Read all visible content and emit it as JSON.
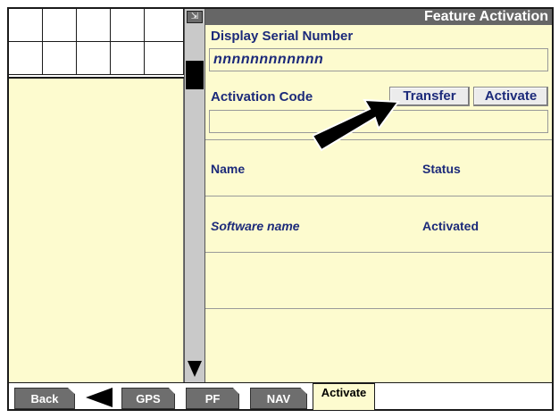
{
  "header": {
    "title": "Feature Activation"
  },
  "serial": {
    "label": "Display Serial Number",
    "value": "nnnnnnnnnnnn"
  },
  "activation": {
    "label": "Activation Code",
    "value": "",
    "transfer_label": "Transfer",
    "activate_label": "Activate"
  },
  "table": {
    "columns": [
      "Name",
      "Status"
    ],
    "rows": [
      {
        "name": "Software name",
        "status": "Activated"
      }
    ]
  },
  "tabs": {
    "back": "Back",
    "gps": "GPS",
    "pf": "PF",
    "nav": "NAV",
    "activate": "Activate"
  },
  "icons": {
    "pointer": "black-arrow-icon",
    "back": "left-arrow-icon",
    "scroll_down": "down-arrow-icon"
  },
  "colors": {
    "background": "#fdfbcf",
    "titlebar": "#666666",
    "text": "#1c2a7a"
  }
}
